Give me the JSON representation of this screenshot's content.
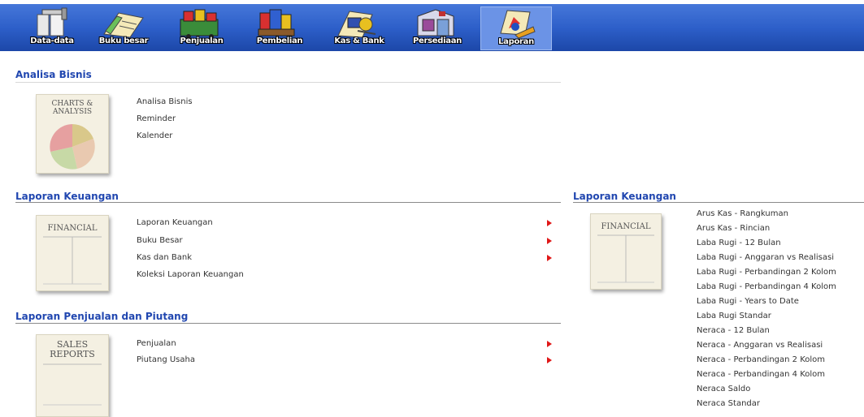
{
  "toolbar": {
    "items": [
      {
        "label": "Data-data",
        "icon": "data-icon"
      },
      {
        "label": "Buku besar",
        "icon": "ledger-icon"
      },
      {
        "label": "Penjualan",
        "icon": "sales-icon"
      },
      {
        "label": "Pembelian",
        "icon": "purchase-icon"
      },
      {
        "label": "Kas & Bank",
        "icon": "cash-bank-icon"
      },
      {
        "label": "Persediaan",
        "icon": "inventory-icon"
      },
      {
        "label": "Laporan",
        "icon": "report-icon",
        "active": true
      }
    ]
  },
  "analisa": {
    "title": "Analisa Bisnis",
    "thumb_title": "CHARTS & ANALYSIS",
    "links": [
      "Analisa Bisnis",
      "Reminder",
      "Kalender"
    ]
  },
  "keuangan": {
    "title": "Laporan Keuangan",
    "thumb_title": "FINANCIAL",
    "links": [
      "Laporan Keuangan",
      "Buku Besar",
      "Kas dan Bank",
      "Koleksi Laporan Keuangan"
    ]
  },
  "penjualan": {
    "title": "Laporan Penjualan dan Piutang",
    "thumb_title": "SALES REPORTS",
    "links": [
      "Penjualan",
      "Piutang Usaha"
    ]
  },
  "keuangan_detail": {
    "title": "Laporan Keuangan",
    "thumb_title": "FINANCIAL",
    "links": [
      "Arus Kas - Rangkuman",
      "Arus Kas - Rincian",
      "Laba Rugi - 12 Bulan",
      "Laba Rugi - Anggaran vs Realisasi",
      "Laba Rugi - Perbandingan 2 Kolom",
      "Laba Rugi - Perbandingan 4 Kolom",
      "Laba Rugi - Years to Date",
      "Laba Rugi Standar",
      "Neraca - 12 Bulan",
      "Neraca - Anggaran vs Realisasi",
      "Neraca - Perbandingan 2 Kolom",
      "Neraca - Perbandingan 4 Kolom",
      "Neraca Saldo",
      "Neraca Standar"
    ]
  },
  "colors": {
    "toolbar": "#2d5fc9",
    "section_title": "#2147b0",
    "arrow": "#e01818"
  }
}
